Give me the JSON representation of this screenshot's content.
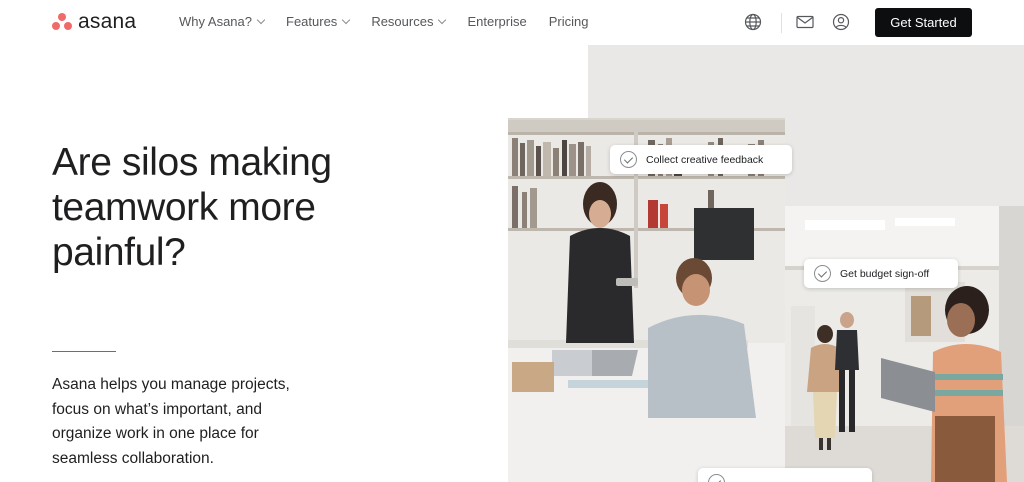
{
  "brand": {
    "name": "asana",
    "accent": "#f06a6a"
  },
  "nav": {
    "items": [
      {
        "label": "Why Asana?",
        "dropdown": true
      },
      {
        "label": "Features",
        "dropdown": true
      },
      {
        "label": "Resources",
        "dropdown": true
      },
      {
        "label": "Enterprise",
        "dropdown": false
      },
      {
        "label": "Pricing",
        "dropdown": false
      }
    ],
    "icons": [
      "globe-icon",
      "mail-icon",
      "user-icon"
    ],
    "cta_label": "Get Started"
  },
  "hero": {
    "headline": "Are silos making teamwork more painful?",
    "body": "Asana helps you manage projects, focus on what’s important, and organize work in one place for seamless collaboration."
  },
  "task_chips": [
    {
      "label": "Collect creative feedback"
    },
    {
      "label": "Get budget sign-off"
    },
    {
      "label": ""
    }
  ],
  "colors": {
    "cta_bg": "#0d0e10",
    "panel_bg": "#e9e8e6"
  }
}
